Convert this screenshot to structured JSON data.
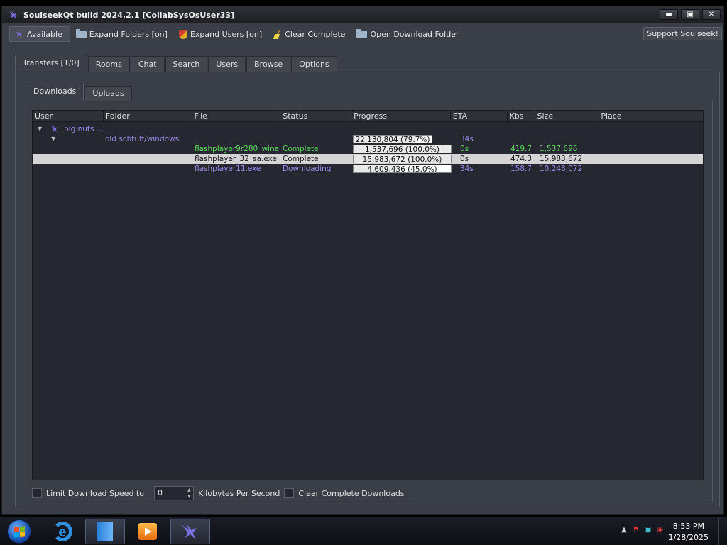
{
  "window": {
    "title": "SoulseekQt build 2024.2.1 [CollabSysOsUser33]",
    "controls": [
      "▬",
      "▣",
      "✕"
    ]
  },
  "toolbar": {
    "available": "Available",
    "expand_folders": "Expand Folders [on]",
    "expand_users": "Expand Users [on]",
    "clear_complete": "Clear Complete",
    "open_download_folder": "Open Download Folder",
    "support": "Support Soulseek!"
  },
  "main_tabs": [
    "Transfers [1/0]",
    "Rooms",
    "Chat",
    "Search",
    "Users",
    "Browse",
    "Options"
  ],
  "sub_tabs": [
    "Downloads",
    "Uploads"
  ],
  "columns": [
    "User",
    "Folder",
    "File",
    "Status",
    "Progress",
    "ETA",
    "Kbs",
    "Size",
    "Place"
  ],
  "tree": {
    "user": "big nuts ...",
    "folder": "old schtuff/windows",
    "folder_progress": "22,130,804 (79.7%)",
    "folder_progress_frac": 0.797,
    "folder_eta": "34s"
  },
  "files": [
    {
      "file": "flashplayer9r280_wina...",
      "status": "Complete",
      "progress": "1,537,696 (100.0%)",
      "frac": 1.0,
      "eta": "0s",
      "kbs": "419.7",
      "size": "1,537,696",
      "color": "#5ed45e",
      "selected": false
    },
    {
      "file": "flashplayer_32_sa.exe",
      "status": "Complete",
      "progress": "15,983,672 (100.0%)",
      "frac": 1.0,
      "eta": "0s",
      "kbs": "474.3",
      "size": "15,983,672",
      "color": "#1a1a1a",
      "selected": true
    },
    {
      "file": "flashplayer11.exe",
      "status": "Downloading",
      "progress": "4,609,436 (45.0%)",
      "frac": 0.45,
      "eta": "34s",
      "kbs": "158.7",
      "size": "10,248,072",
      "color": "#9d88e6",
      "selected": false
    }
  ],
  "bottom": {
    "limit_label": "Limit Download Speed to",
    "speed_value": "0",
    "units_label": "Kilobytes Per Second",
    "clear_label": "Clear Complete Downloads"
  },
  "taskbar": {
    "time": "8:53 PM",
    "date": "1/28/2025",
    "tray_icons": [
      "show-hidden-icon",
      "flag-icon",
      "network-icon",
      "volume-icon"
    ]
  }
}
